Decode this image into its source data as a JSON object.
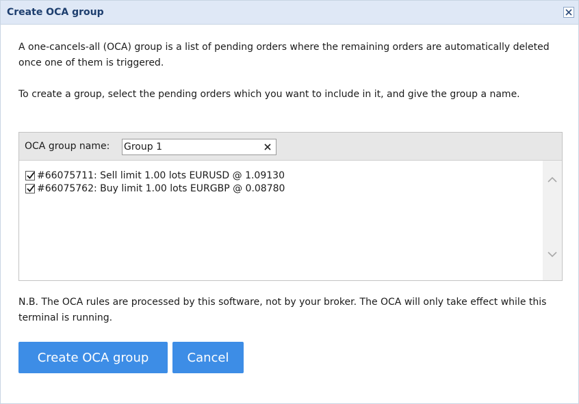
{
  "dialog": {
    "title": "Create OCA group",
    "intro_1": "A one-cancels-all (OCA) group is a list of pending orders where the remaining orders are automatically deleted once one of them is triggered.",
    "intro_2": "To create a group, select the pending orders which you want to include in it, and give the group a name.",
    "oca_name_label": "OCA group name:",
    "oca_name_value": "Group 1",
    "orders": [
      {
        "text": "#66075711: Sell limit 1.00 lots EURUSD @ 1.09130",
        "checked": true
      },
      {
        "text": "#66075762: Buy limit 1.00 lots EURGBP @ 0.08780",
        "checked": true
      }
    ],
    "note": "N.B. The OCA rules are processed by this software, not by your broker. The OCA will only take effect while this terminal is running.",
    "create_button": "Create OCA group",
    "cancel_button": "Cancel"
  },
  "colors": {
    "title_text": "#1d3e6e",
    "titlebar_bg": "#dfe8f6",
    "button_bg": "#3d8de6"
  },
  "icons": {
    "close": "close-icon",
    "clear": "clear-icon",
    "check": "checkmark-icon",
    "up": "chevron-up-icon",
    "down": "chevron-down-icon"
  }
}
